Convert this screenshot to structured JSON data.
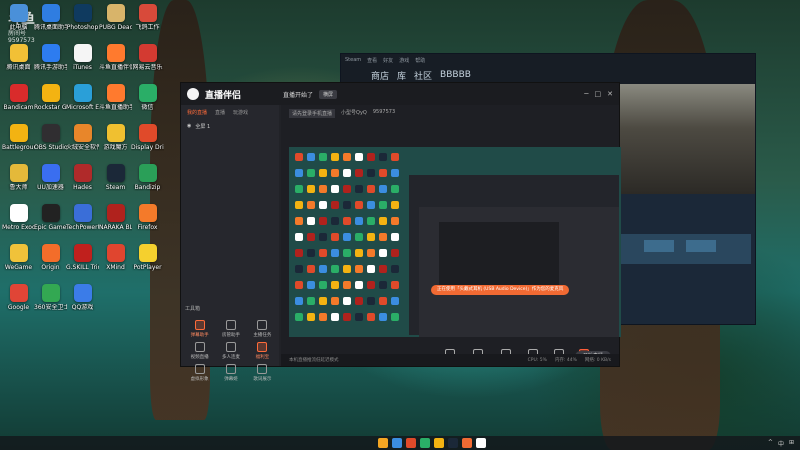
{
  "watermark": {
    "logo": "斗鱼",
    "line1": "房间号",
    "line2": "9597573"
  },
  "desktop_icons": [
    {
      "label": "此电脑",
      "color": "#4a90d9"
    },
    {
      "label": "腾讯桌面助手",
      "color": "#2f7de1"
    },
    {
      "label": "Photoshop",
      "color": "#0f3a5f"
    },
    {
      "label": "PUBG Dead",
      "color": "#d8b46a"
    },
    {
      "label": "飞鸽工作",
      "color": "#d84a3a"
    },
    {
      "label": "腾讯桌面",
      "color": "#f2c036"
    },
    {
      "label": "腾讯手游助手",
      "color": "#2d7cf0"
    },
    {
      "label": "iTunes",
      "color": "#f5f5f5"
    },
    {
      "label": "斗鱼直播伴侣",
      "color": "#ff7a2e"
    },
    {
      "label": "网易云音乐",
      "color": "#d33a31"
    },
    {
      "label": "Bandicam",
      "color": "#d92b2b"
    },
    {
      "label": "Rockstar Games",
      "color": "#f3b312"
    },
    {
      "label": "Microsoft Edge",
      "color": "#2a9fd8"
    },
    {
      "label": "斗鱼直播助手",
      "color": "#ff7a2e"
    },
    {
      "label": "微信",
      "color": "#2aae67"
    },
    {
      "label": "Battlegrounds",
      "color": "#f3b312"
    },
    {
      "label": "OBS Studio",
      "color": "#302e31"
    },
    {
      "label": "火绒安全软件",
      "color": "#e8862a"
    },
    {
      "label": "游戏魔方",
      "color": "#f0c030"
    },
    {
      "label": "Display Driver",
      "color": "#e04a2a"
    },
    {
      "label": "鲁大师",
      "color": "#e4b93a"
    },
    {
      "label": "UU加速器",
      "color": "#3a6ef0"
    },
    {
      "label": "Hades",
      "color": "#b02a2a"
    },
    {
      "label": "Steam",
      "color": "#1b2838"
    },
    {
      "label": "Bandizip",
      "color": "#2a9f58"
    },
    {
      "label": "Metro Exodus",
      "color": "#ffffff"
    },
    {
      "label": "Epic Games Launcher",
      "color": "#222"
    },
    {
      "label": "TechPowerUp GPU-Z",
      "color": "#3a6ed8"
    },
    {
      "label": "NARAKA BLADEPOINT",
      "color": "#b0221d"
    },
    {
      "label": "Firefox",
      "color": "#f47a2a"
    },
    {
      "label": "WeGame",
      "color": "#f0c23a"
    },
    {
      "label": "Origin",
      "color": "#f36d2a"
    },
    {
      "label": "G.SKILL Trident",
      "color": "#c0201d"
    },
    {
      "label": "XMind",
      "color": "#e0452f"
    },
    {
      "label": "PotPlayer",
      "color": "#f5d02e"
    },
    {
      "label": "Google",
      "color": "#e04536"
    },
    {
      "label": "360安全卫士",
      "color": "#33a852"
    },
    {
      "label": "QQ游戏",
      "color": "#3b7ce8"
    }
  ],
  "steam": {
    "menu": [
      "Steam",
      "查看",
      "好友",
      "游戏",
      "帮助"
    ],
    "nav": [
      "商店",
      "库",
      "社区",
      "BBBBB"
    ]
  },
  "live": {
    "brand": "直播伴侣",
    "status": "直播开始了",
    "badge": "横屏",
    "tabs": [
      "我的直播",
      "直播",
      "玩游戏"
    ],
    "scene": "全屏 1",
    "info_chips": [
      "请先登录手机直播",
      "小型号QyQ",
      "9597573"
    ],
    "tools_title": "工具箱",
    "tools": [
      {
        "label": "弹幕助手",
        "orange": true
      },
      {
        "label": "房管助手",
        "orange": false
      },
      {
        "label": "主播任务",
        "orange": false
      },
      {
        "label": "视频直播",
        "orange": false
      },
      {
        "label": "多人连麦",
        "orange": false
      },
      {
        "label": "福利宝",
        "orange": true
      },
      {
        "label": "虚拟形象",
        "orange": false
      },
      {
        "label": "弹幕姬",
        "orange": false
      },
      {
        "label": "歌词展示",
        "orange": false
      }
    ],
    "toast": "正在使用「头戴式耳机 (USB Audio Device)」作为您的麦克风",
    "bottom_items": [
      {
        "label": "直播屏幕",
        "hl": false
      },
      {
        "label": "摄像头",
        "hl": false
      },
      {
        "label": "手机投屏",
        "hl": false
      },
      {
        "label": "添加源",
        "hl": false
      },
      {
        "label": "麦克风",
        "hl": false
      },
      {
        "label": "扬声器",
        "hl": true
      }
    ],
    "start_label": "开始直播",
    "statusbar": [
      "本机直播推流低延迟模式",
      "CPU: 5%",
      "内存: 44%",
      "网络: 0 KB/s"
    ]
  },
  "taskbar": {
    "icons": [
      "#f4a623",
      "#3b8de0",
      "#e04a2a",
      "#2aae67",
      "#f3b312",
      "#1b2838",
      "#f16a33",
      "#ffffff"
    ],
    "tray": [
      "^",
      "中",
      "⊞"
    ]
  }
}
